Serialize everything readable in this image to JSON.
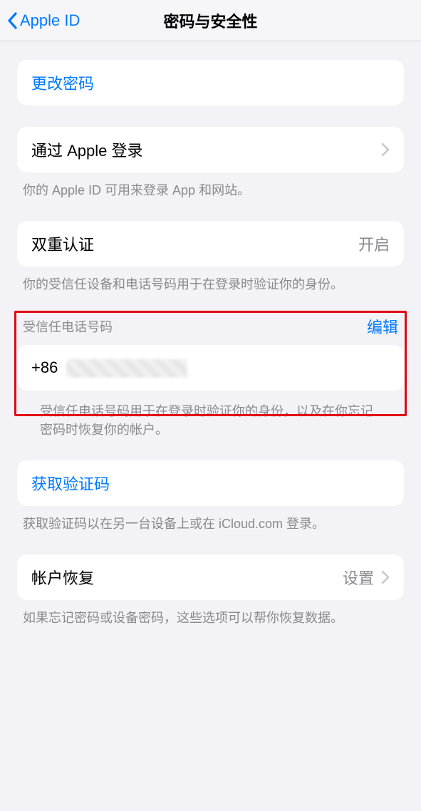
{
  "nav": {
    "back_label": "Apple ID",
    "title": "密码与安全性"
  },
  "change_password": {
    "label": "更改密码"
  },
  "sign_in_with_apple": {
    "label": "通过 Apple 登录",
    "footer": "你的 Apple ID 可用来登录 App 和网站。"
  },
  "two_factor": {
    "label": "双重认证",
    "status": "开启",
    "footer": "你的受信任设备和电话号码用于在登录时验证你的身份。"
  },
  "trusted_phone": {
    "header": "受信任电话号码",
    "edit": "编辑",
    "prefix": "+86",
    "footer": "受信任电话号码用于在登录时验证你的身份，以及在你忘记密码时恢复你的帐户。"
  },
  "get_code": {
    "label": "获取验证码",
    "footer": "获取验证码以在另一台设备上或在 iCloud.com 登录。"
  },
  "account_recovery": {
    "label": "帐户恢复",
    "value": "设置",
    "footer": "如果忘记密码或设备密码，这些选项可以帮你恢复数据。"
  }
}
